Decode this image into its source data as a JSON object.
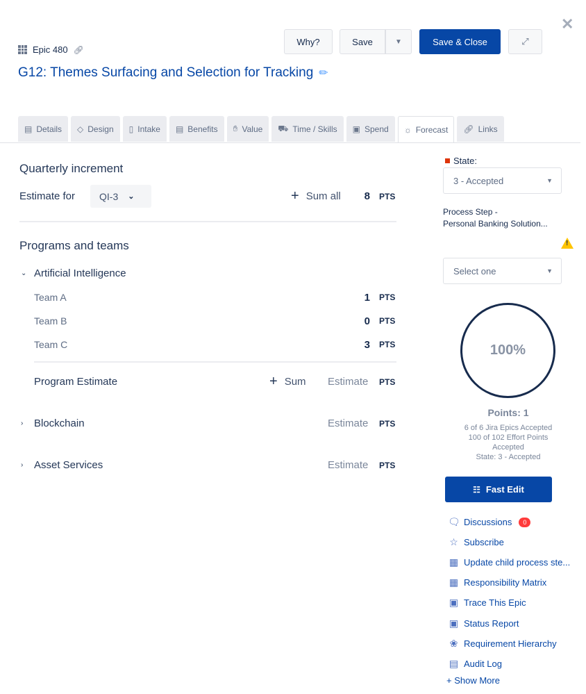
{
  "header": {
    "epic_label": "Epic 480",
    "title": "G12: Themes Surfacing and Selection for Tracking",
    "buttons": {
      "why": "Why?",
      "save": "Save",
      "save_close": "Save & Close"
    }
  },
  "tabs": [
    {
      "label": "Details",
      "icon": "list-icon"
    },
    {
      "label": "Design",
      "icon": "diamond-icon"
    },
    {
      "label": "Intake",
      "icon": "clipboard-icon"
    },
    {
      "label": "Benefits",
      "icon": "briefcase-icon"
    },
    {
      "label": "Value",
      "icon": "thumbs-up-icon"
    },
    {
      "label": "Time / Skills",
      "icon": "truck-icon"
    },
    {
      "label": "Spend",
      "icon": "money-icon"
    },
    {
      "label": "Forecast",
      "icon": "sun-icon",
      "active": true
    },
    {
      "label": "Links",
      "icon": "link-icon"
    }
  ],
  "main": {
    "quarterly_heading": "Quarterly increment",
    "estimate_for_label": "Estimate for",
    "qi_value": "QI-3",
    "sum_all_label": "Sum all",
    "total_points": "8",
    "pts": "PTS",
    "programs_heading": "Programs and teams",
    "programs": [
      {
        "name": "Artificial Intelligence",
        "expanded": true,
        "teams": [
          {
            "name": "Team A",
            "points": "1"
          },
          {
            "name": "Team B",
            "points": "0"
          },
          {
            "name": "Team C",
            "points": "3"
          }
        ],
        "program_estimate_label": "Program Estimate",
        "sum_label": "Sum",
        "estimate_label": "Estimate"
      },
      {
        "name": "Blockchain",
        "expanded": false,
        "estimate_label": "Estimate"
      },
      {
        "name": "Asset Services",
        "expanded": false,
        "estimate_label": "Estimate"
      }
    ]
  },
  "sidebar": {
    "state_label": "State:",
    "state_value": "3 - Accepted",
    "process_step_line1": "Process Step -",
    "process_step_line2": "Personal Banking Solution...",
    "select_placeholder": "Select one",
    "progress_percent": "100%",
    "progress_fraction": 1.0,
    "points_line": "Points: 1",
    "stats": [
      "6 of 6 Jira Epics Accepted",
      "100 of 102 Effort Points",
      "Accepted",
      "State: 3 - Accepted"
    ],
    "fast_edit": "Fast Edit",
    "links": [
      {
        "label": "Discussions",
        "icon": "chat-icon",
        "badge": "0"
      },
      {
        "label": "Subscribe",
        "icon": "star-icon"
      },
      {
        "label": "Update child process ste...",
        "icon": "grid-icon"
      },
      {
        "label": "Responsibility Matrix",
        "icon": "grid-icon"
      },
      {
        "label": "Trace This Epic",
        "icon": "window-icon"
      },
      {
        "label": "Status Report",
        "icon": "window-icon"
      },
      {
        "label": "Requirement Hierarchy",
        "icon": "puzzle-icon"
      },
      {
        "label": "Audit Log",
        "icon": "log-icon"
      }
    ],
    "show_more": "+ Show More"
  },
  "colors": {
    "primary": "#0747a6",
    "state_marker": "#de350b",
    "warning": "#ffc400",
    "badge": "#ff3b3b"
  }
}
